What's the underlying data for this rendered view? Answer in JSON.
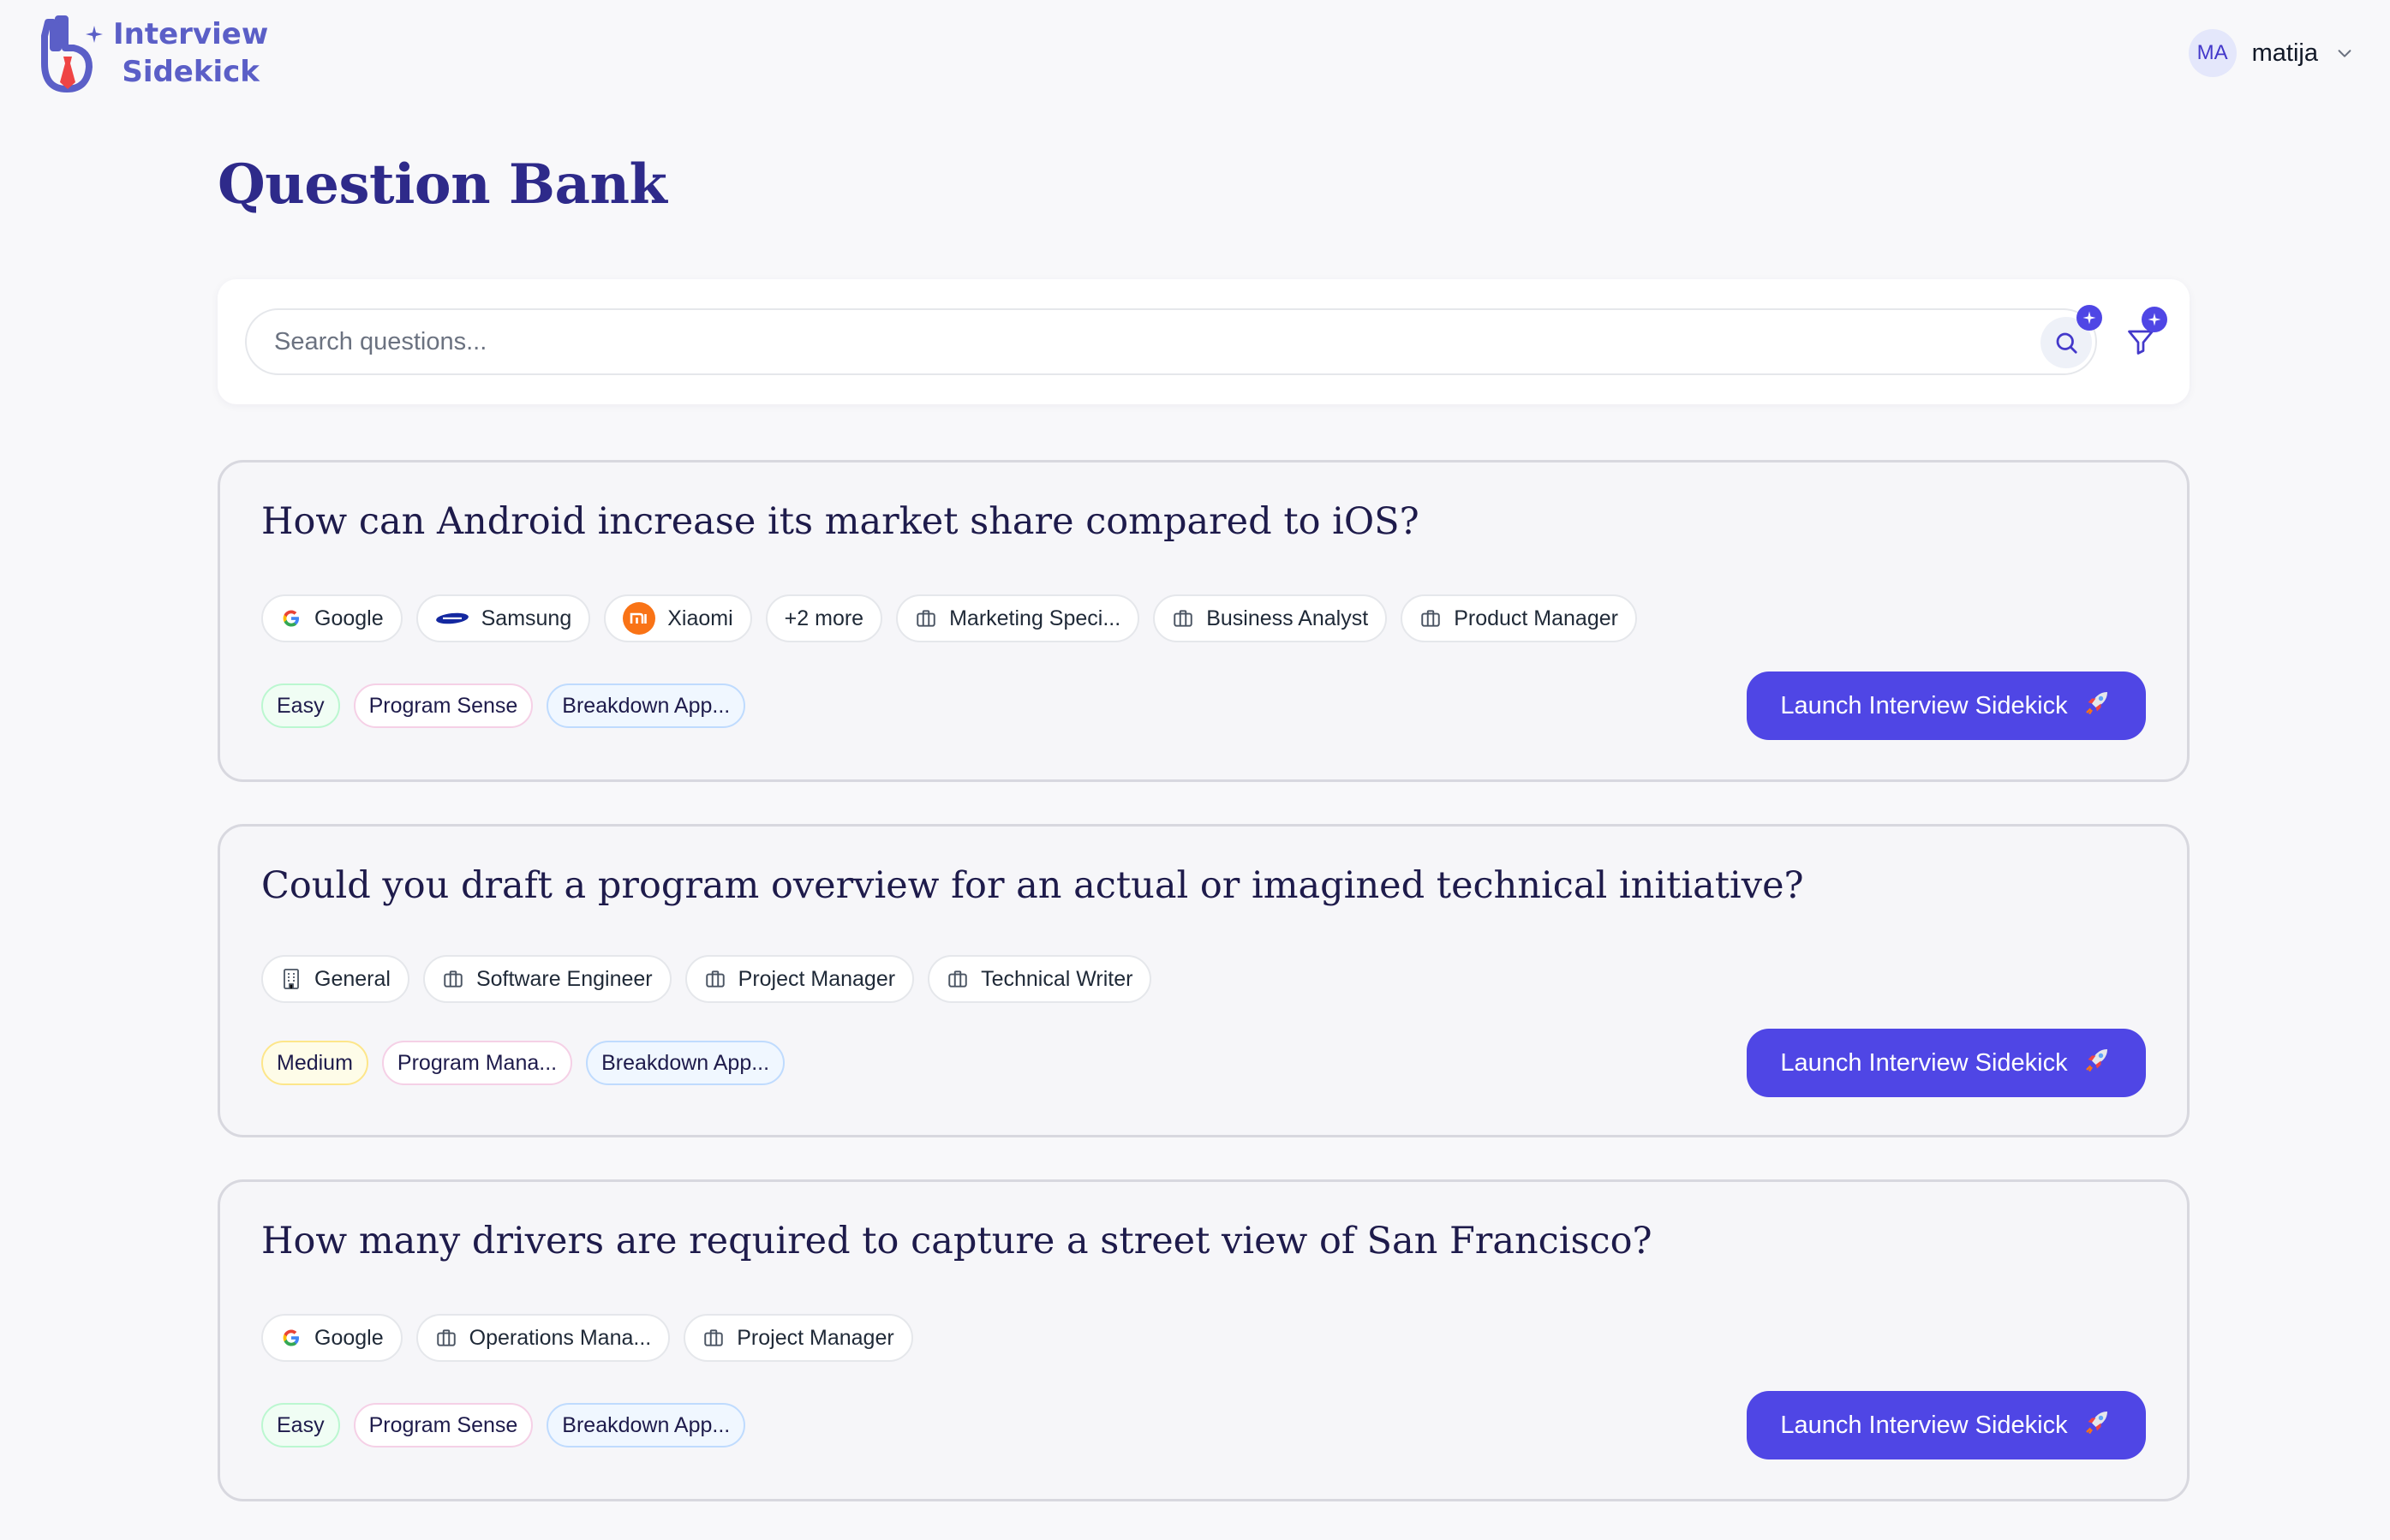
{
  "app": {
    "logo_line1": "Interview",
    "logo_line2": "Sidekick"
  },
  "user": {
    "initials": "MA",
    "name": "matija"
  },
  "page": {
    "title": "Question Bank"
  },
  "search": {
    "placeholder": "Search questions..."
  },
  "questions": [
    {
      "title": "How can Android increase its market share compared to iOS?",
      "tags": [
        {
          "label": "Google",
          "icon": "google-icon"
        },
        {
          "label": "Samsung",
          "icon": "samsung-icon"
        },
        {
          "label": "Xiaomi",
          "icon": "xiaomi-icon"
        },
        {
          "label": "+2 more",
          "icon": ""
        },
        {
          "label": "Marketing Speci...",
          "icon": "briefcase-icon"
        },
        {
          "label": "Business Analyst",
          "icon": "briefcase-icon"
        },
        {
          "label": "Product Manager",
          "icon": "briefcase-icon"
        }
      ],
      "difficulty": "Easy",
      "category": "Program Sense",
      "type": "Breakdown App...",
      "action": "Launch Interview Sidekick"
    },
    {
      "title": "Could you draft a program overview for an actual or imagined technical initiative?",
      "tags": [
        {
          "label": "General",
          "icon": "building-icon"
        },
        {
          "label": "Software Engineer",
          "icon": "briefcase-icon"
        },
        {
          "label": "Project Manager",
          "icon": "briefcase-icon"
        },
        {
          "label": "Technical Writer",
          "icon": "briefcase-icon"
        }
      ],
      "difficulty": "Medium",
      "category": "Program Mana...",
      "type": "Breakdown App...",
      "action": "Launch Interview Sidekick"
    },
    {
      "title": "How many drivers are required to capture a street view of San Francisco?",
      "tags": [
        {
          "label": "Google",
          "icon": "google-icon"
        },
        {
          "label": "Operations Mana...",
          "icon": "briefcase-icon"
        },
        {
          "label": "Project Manager",
          "icon": "briefcase-icon"
        }
      ],
      "difficulty": "Easy",
      "category": "Program Sense",
      "type": "Breakdown App...",
      "action": "Launch Interview Sidekick"
    }
  ],
  "colors": {
    "primary": "#4f46e5",
    "title": "#2e2a8a",
    "background": "#f8f8fa"
  }
}
